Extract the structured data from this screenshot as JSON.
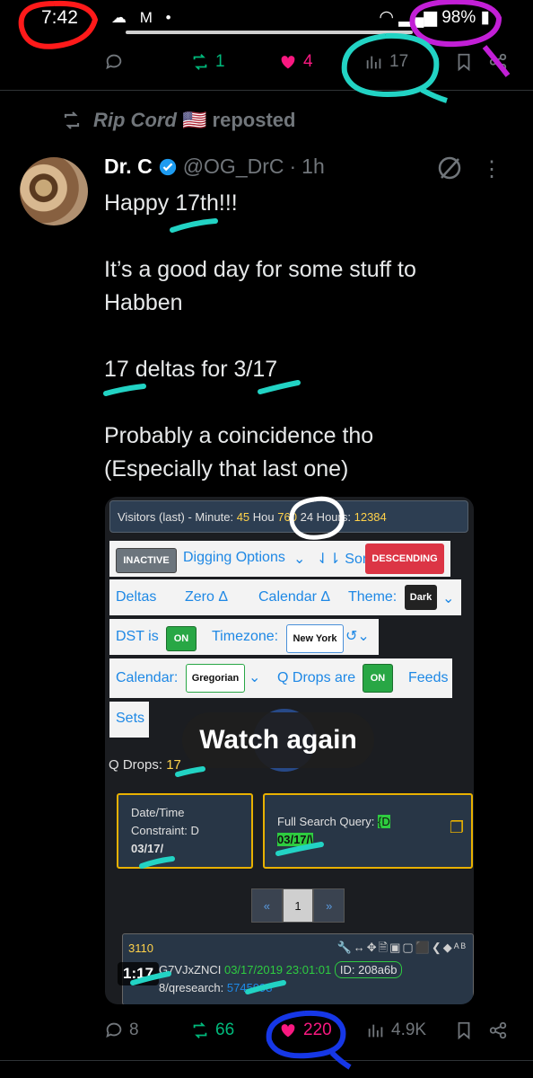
{
  "status_bar": {
    "time": "7:42",
    "left_icons": "☁ M •",
    "battery": "98%"
  },
  "top_actions": {
    "replies": "",
    "reposts": "1",
    "likes": "4",
    "views": "17"
  },
  "repost_banner": {
    "name": "Rip Cord",
    "flag": "🇺🇸",
    "text": "reposted"
  },
  "tweet": {
    "display_name": "Dr. C",
    "handle": "@OG_DrC",
    "separator": "·",
    "time": "1h",
    "lines": [
      "Happy 17th!!!",
      "",
      "It’s a good day for some stuff to",
      "Habben",
      "",
      "17 deltas for 3/17",
      "",
      "Probably a coincidence tho",
      "(Especially that last one)"
    ]
  },
  "media": {
    "visitors_label": "Visitors (last) - Minute:",
    "minute": "45",
    "hour_label": "Hou",
    "hour": "760",
    "day_label": "24 Hours:",
    "day": "12384",
    "row1": {
      "inactive": "INACTIVE",
      "digging": "Digging Options",
      "sort": "Sort",
      "descending": "DESCENDING"
    },
    "row2": {
      "deltas": "Deltas",
      "zero": "Zero Δ",
      "calendar": "Calendar Δ",
      "theme_label": "Theme:",
      "theme": "Dark"
    },
    "row3": {
      "dst_label": "DST is",
      "dst": "ON",
      "tz_label": "Timezone:",
      "tz": "New York"
    },
    "row4": {
      "cal_label": "Calendar:",
      "cal": "Gregorian",
      "qdrops_label": "Q Drops are",
      "qdrops": "ON",
      "feeds": "Feeds"
    },
    "row5": {
      "sets": "Sets"
    },
    "qdrops_count_label": "Q Drops:",
    "qdrops_count": "17",
    "box1": {
      "l1": "Date/Time",
      "l2": "Constraint: D",
      "l3": "03/17/"
    },
    "box2": {
      "l1": "Full Search Query:",
      "l1b": "{D",
      "l2": "03/17/\\"
    },
    "pager": [
      "«",
      "1",
      "»"
    ],
    "result": {
      "num": "3110",
      "tools": "🔧↔✥🗎▣▢⬛❮◆ᴬᴮ",
      "trip_prefix": "G7VJxZNCI",
      "date": "03/17/2019 23:01:01",
      "id": "ID: 208a6b",
      "link_prefix": "8",
      "link": "/qresearch:",
      "link_num": "5745998"
    },
    "watch_again": "Watch again",
    "duration": "1:17"
  },
  "bottom_actions": {
    "replies": "8",
    "reposts": "66",
    "likes": "220",
    "views": "4.9K"
  },
  "colors": {
    "repost_green": "#00ba7c",
    "like_pink": "#f91880",
    "verified_blue": "#1d9bf0",
    "annotation_red": "#ff1a1a",
    "annotation_purple": "#c21fd6",
    "annotation_teal": "#22d3c4",
    "annotation_blue": "#1637e6"
  }
}
